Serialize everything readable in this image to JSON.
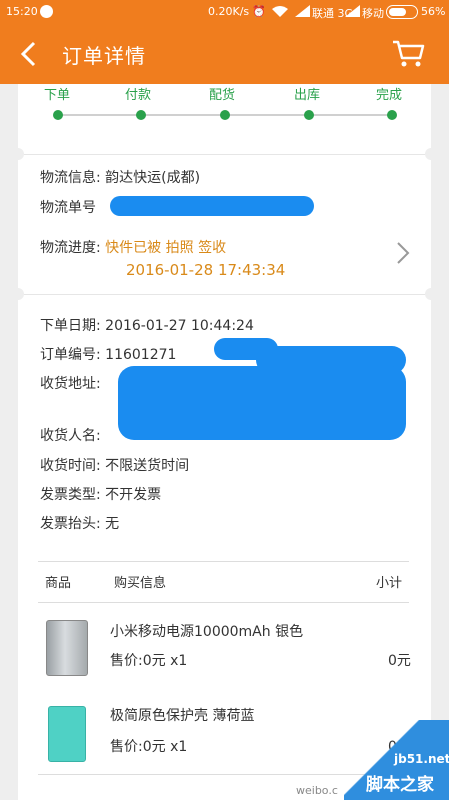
{
  "status_bar": {
    "time": "15:20",
    "speed": "0.20K/s",
    "carrier1": "联通 3G",
    "carrier2": "移动",
    "battery": "56%",
    "battery_level": 0.56
  },
  "header": {
    "title": "订单详情"
  },
  "progress": {
    "steps": [
      "下单",
      "付款",
      "配货",
      "出库",
      "完成"
    ],
    "completed": 5
  },
  "logistics": {
    "company_label": "物流信息:",
    "company_value": "韵达快运(成都)",
    "number_label": "物流单号",
    "progress_label": "物流进度:",
    "progress_status": "快件已被 拍照 签收",
    "progress_time": "2016-01-28 17:43:34"
  },
  "order": {
    "date_label": "下单日期:",
    "date_value": "2016-01-27 10:44:24",
    "number_label": "订单编号:",
    "number_value": "11601271",
    "address_label": "收货地址:",
    "receiver_label": "收货人名:",
    "delivery_time_label": "收货时间:",
    "delivery_time_value": "不限送货时间",
    "invoice_type_label": "发票类型:",
    "invoice_type_value": "不开发票",
    "invoice_title_label": "发票抬头:",
    "invoice_title_value": "无"
  },
  "items_table": {
    "headers": [
      "商品",
      "购买信息",
      "小计"
    ],
    "rows": [
      {
        "name": "小米移动电源10000mAh 银色",
        "price": "售价:0元 x1",
        "subtotal": "0元"
      },
      {
        "name": "极简原色保护壳 薄荷蓝",
        "price": "售价:0元 x1",
        "subtotal": "0元"
      }
    ]
  },
  "watermarks": {
    "weibo": "weibo.c",
    "site_url": "jb51.net",
    "site_name": "脚本之家"
  },
  "colors": {
    "brand": "#f07d1e",
    "progress": "#2aa14b",
    "highlight": "#d98a1a",
    "redaction": "#1a8cf0"
  }
}
